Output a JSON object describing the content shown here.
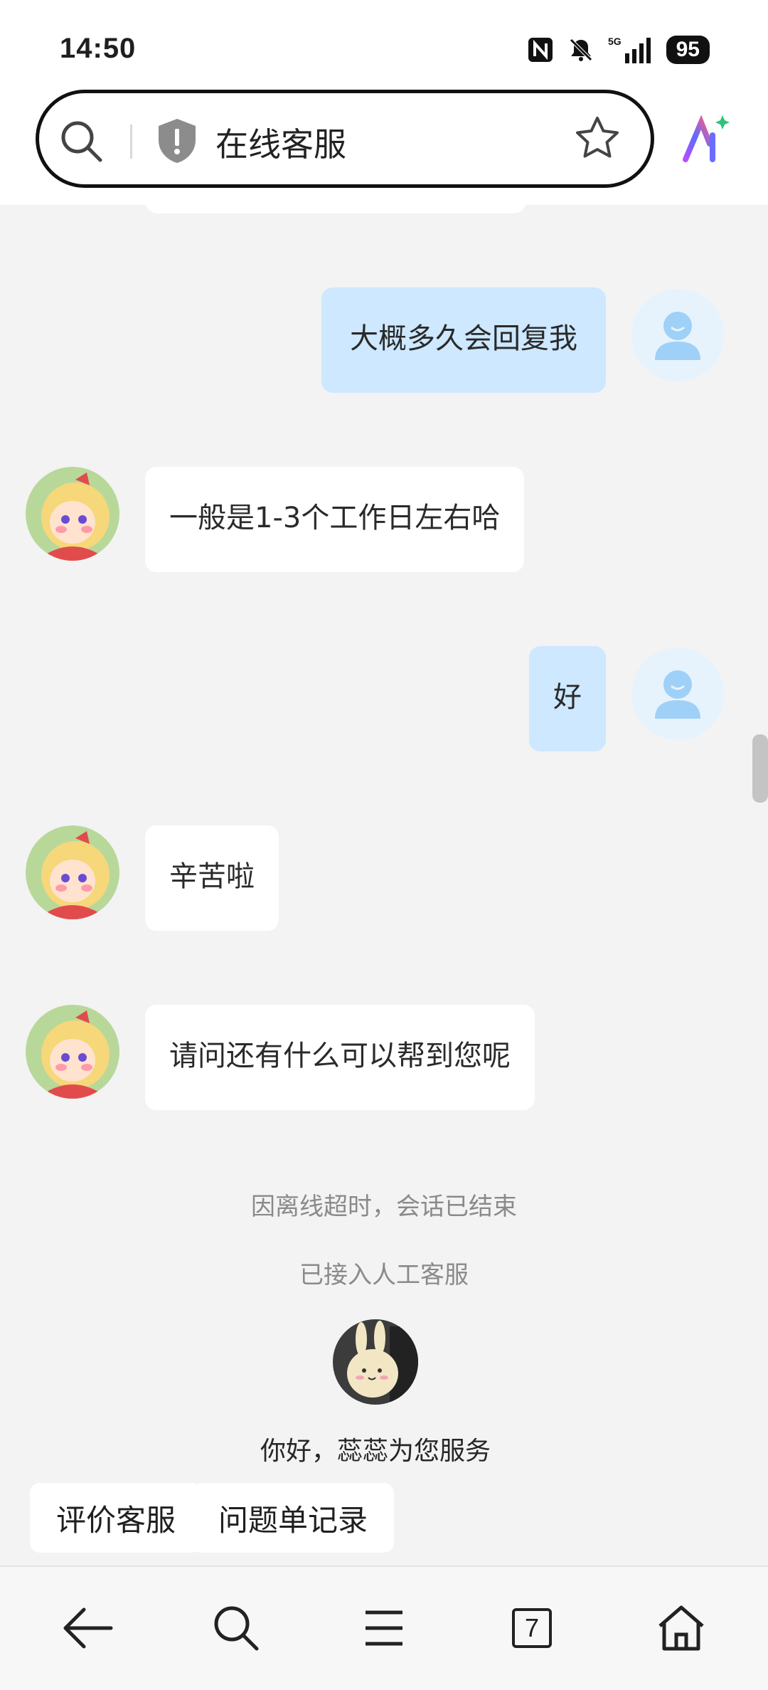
{
  "status_bar": {
    "time": "14:50",
    "battery": "95",
    "network": "5G"
  },
  "address_bar": {
    "title": "在线客服"
  },
  "messages": [
    {
      "from": "user",
      "text": "大概多久会回复我"
    },
    {
      "from": "agent",
      "text": "一般是1-3个工作日左右哈"
    },
    {
      "from": "user",
      "text": "好"
    },
    {
      "from": "agent",
      "text": "辛苦啦"
    },
    {
      "from": "agent",
      "text": "请问还有什么可以帮到您呢"
    }
  ],
  "system_notices": [
    "因离线超时，会话已结束",
    "已接入人工客服"
  ],
  "welcome": "你好，蕊蕊为您服务",
  "quick_actions": [
    "评价客服",
    "问题单记录"
  ],
  "bottom_nav": {
    "tab_count": "7"
  },
  "colors": {
    "user_bubble": "#cde8ff",
    "agent_bubble": "#ffffff",
    "background": "#f3f3f3"
  }
}
